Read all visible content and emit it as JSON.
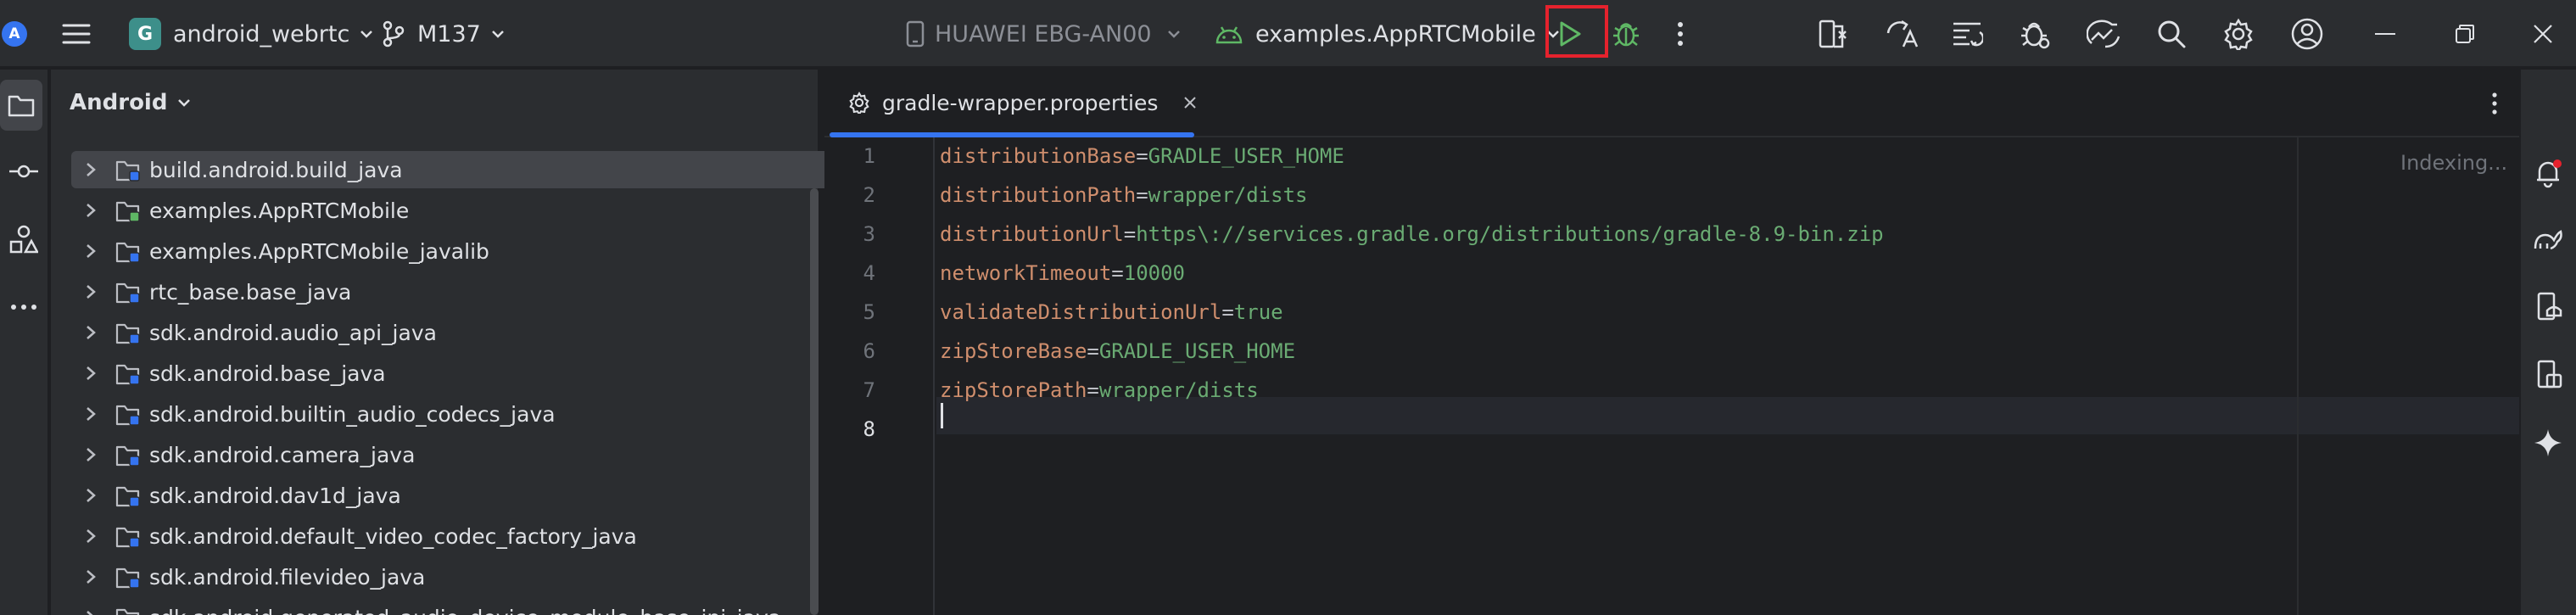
{
  "toolbar": {
    "project_badge": "G",
    "project_name": "android_webrtc",
    "branch": "M137",
    "device": "HUAWEI EBG-AN00",
    "run_config": "examples.AppRTCMobile"
  },
  "project_panel": {
    "title": "Android",
    "items": [
      {
        "label": "build.android.build_java"
      },
      {
        "label": "examples.AppRTCMobile"
      },
      {
        "label": "examples.AppRTCMobile_javalib"
      },
      {
        "label": "rtc_base.base_java"
      },
      {
        "label": "sdk.android.audio_api_java"
      },
      {
        "label": "sdk.android.base_java"
      },
      {
        "label": "sdk.android.builtin_audio_codecs_java"
      },
      {
        "label": "sdk.android.camera_java"
      },
      {
        "label": "sdk.android.dav1d_java"
      },
      {
        "label": "sdk.android.default_video_codec_factory_java"
      },
      {
        "label": "sdk.android.filevideo_java"
      },
      {
        "label": "sdk.android.generated_audio_device_module_base_jni_java"
      }
    ]
  },
  "editor": {
    "tab_label": "gradle-wrapper.properties",
    "status": "Indexing...",
    "lines": [
      {
        "num": "1",
        "key": "distributionBase",
        "eq": "=",
        "value": "GRADLE_USER_HOME"
      },
      {
        "num": "2",
        "key": "distributionPath",
        "eq": "=",
        "value": "wrapper/dists"
      },
      {
        "num": "3",
        "key": "distributionUrl",
        "eq": "=",
        "value": "https\\://services.gradle.org/distributions/gradle-8.9-bin.zip"
      },
      {
        "num": "4",
        "key": "networkTimeout",
        "eq": "=",
        "value": "10000"
      },
      {
        "num": "5",
        "key": "validateDistributionUrl",
        "eq": "=",
        "value": "true"
      },
      {
        "num": "6",
        "key": "zipStoreBase",
        "eq": "=",
        "value": "GRADLE_USER_HOME"
      },
      {
        "num": "7",
        "key": "zipStorePath",
        "eq": "=",
        "value": "wrapper/dists"
      },
      {
        "num": "8",
        "key": "",
        "eq": "",
        "value": ""
      }
    ]
  },
  "colors": {
    "accent": "#3574f0",
    "highlight_box": "#e5222d",
    "run_green": "#5fb865",
    "key_color": "#cf8e6d",
    "value_color": "#6aab73"
  },
  "icons": [
    "app-logo-icon",
    "hamburger-menu-icon",
    "branch-icon",
    "device-icon",
    "android-icon",
    "run-icon",
    "debug-icon",
    "more-icon",
    "build-icon",
    "translate-icon",
    "profiler-icon",
    "bug-icon",
    "analytics-icon",
    "search-icon",
    "gear-icon",
    "account-icon",
    "minimize-icon",
    "restore-icon",
    "close-icon",
    "folder-icon",
    "commit-icon",
    "components-icon",
    "notifications-icon",
    "gemini-icon"
  ]
}
